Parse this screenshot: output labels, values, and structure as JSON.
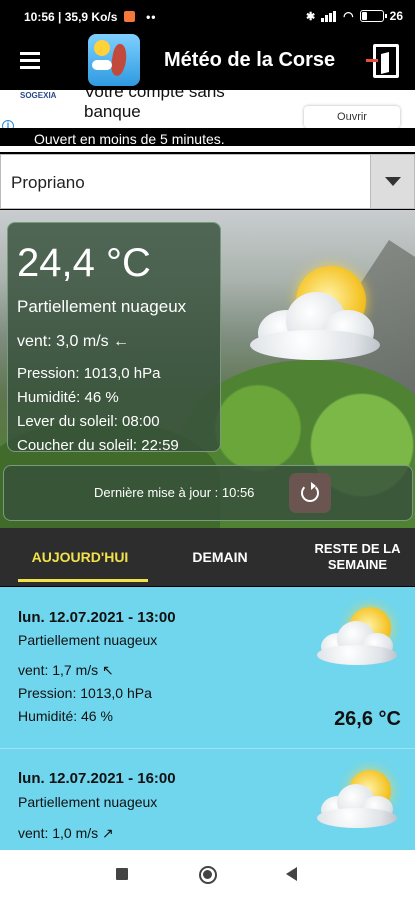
{
  "status_bar": {
    "time_speed": "10:56 | 35,9 Ko/s",
    "dots": "••",
    "battery_label": "26",
    "battery_level_percent": 26
  },
  "app": {
    "title": "Météo de la Corse"
  },
  "ad": {
    "brand": "SOGEXIA",
    "headline": "Votre compte sans banque",
    "button": "Ouvrir",
    "info": "i",
    "subtext": "Ouvert en moins de 5 minutes."
  },
  "city_select": {
    "selected": "Propriano"
  },
  "current": {
    "temperature": "24,4 °C",
    "condition": "Partiellement nuageux",
    "wind": "vent: 3,0 m/s ←",
    "pressure": "Pression: 1013,0 hPa",
    "humidity": "Humidité: 46 %",
    "sunrise": "Lever du soleil: 08:00",
    "sunset": "Coucher du soleil: 22:59"
  },
  "update": {
    "text": "Dernière mise à jour : 10:56"
  },
  "tabs": [
    {
      "label": "AUJOURD'HUI",
      "active": true
    },
    {
      "label": "DEMAIN",
      "active": false
    },
    {
      "label": "RESTE DE LA SEMAINE",
      "active": false
    }
  ],
  "forecast": [
    {
      "datetime": "lun. 12.07.2021 - 13:00",
      "condition": "Partiellement nuageux",
      "wind": "vent: 1,7 m/s ↖",
      "pressure": "Pression: 1013,0 hPa",
      "humidity": "Humidité: 46 %",
      "temperature": "26,6 °C"
    },
    {
      "datetime": "lun. 12.07.2021 - 16:00",
      "condition": "Partiellement nuageux",
      "wind": "vent: 1,0 m/s ↗"
    }
  ],
  "colors": {
    "accent_tab": "#f2e24a",
    "forecast_bg": "#6fd6ee",
    "panel_bg": "#37503c",
    "tab_bar_bg": "#2d2d2d"
  },
  "icons": {
    "menu": "menu-icon",
    "exit": "exit-door-icon",
    "refresh": "refresh-icon",
    "weather": "partly-cloudy-icon"
  }
}
